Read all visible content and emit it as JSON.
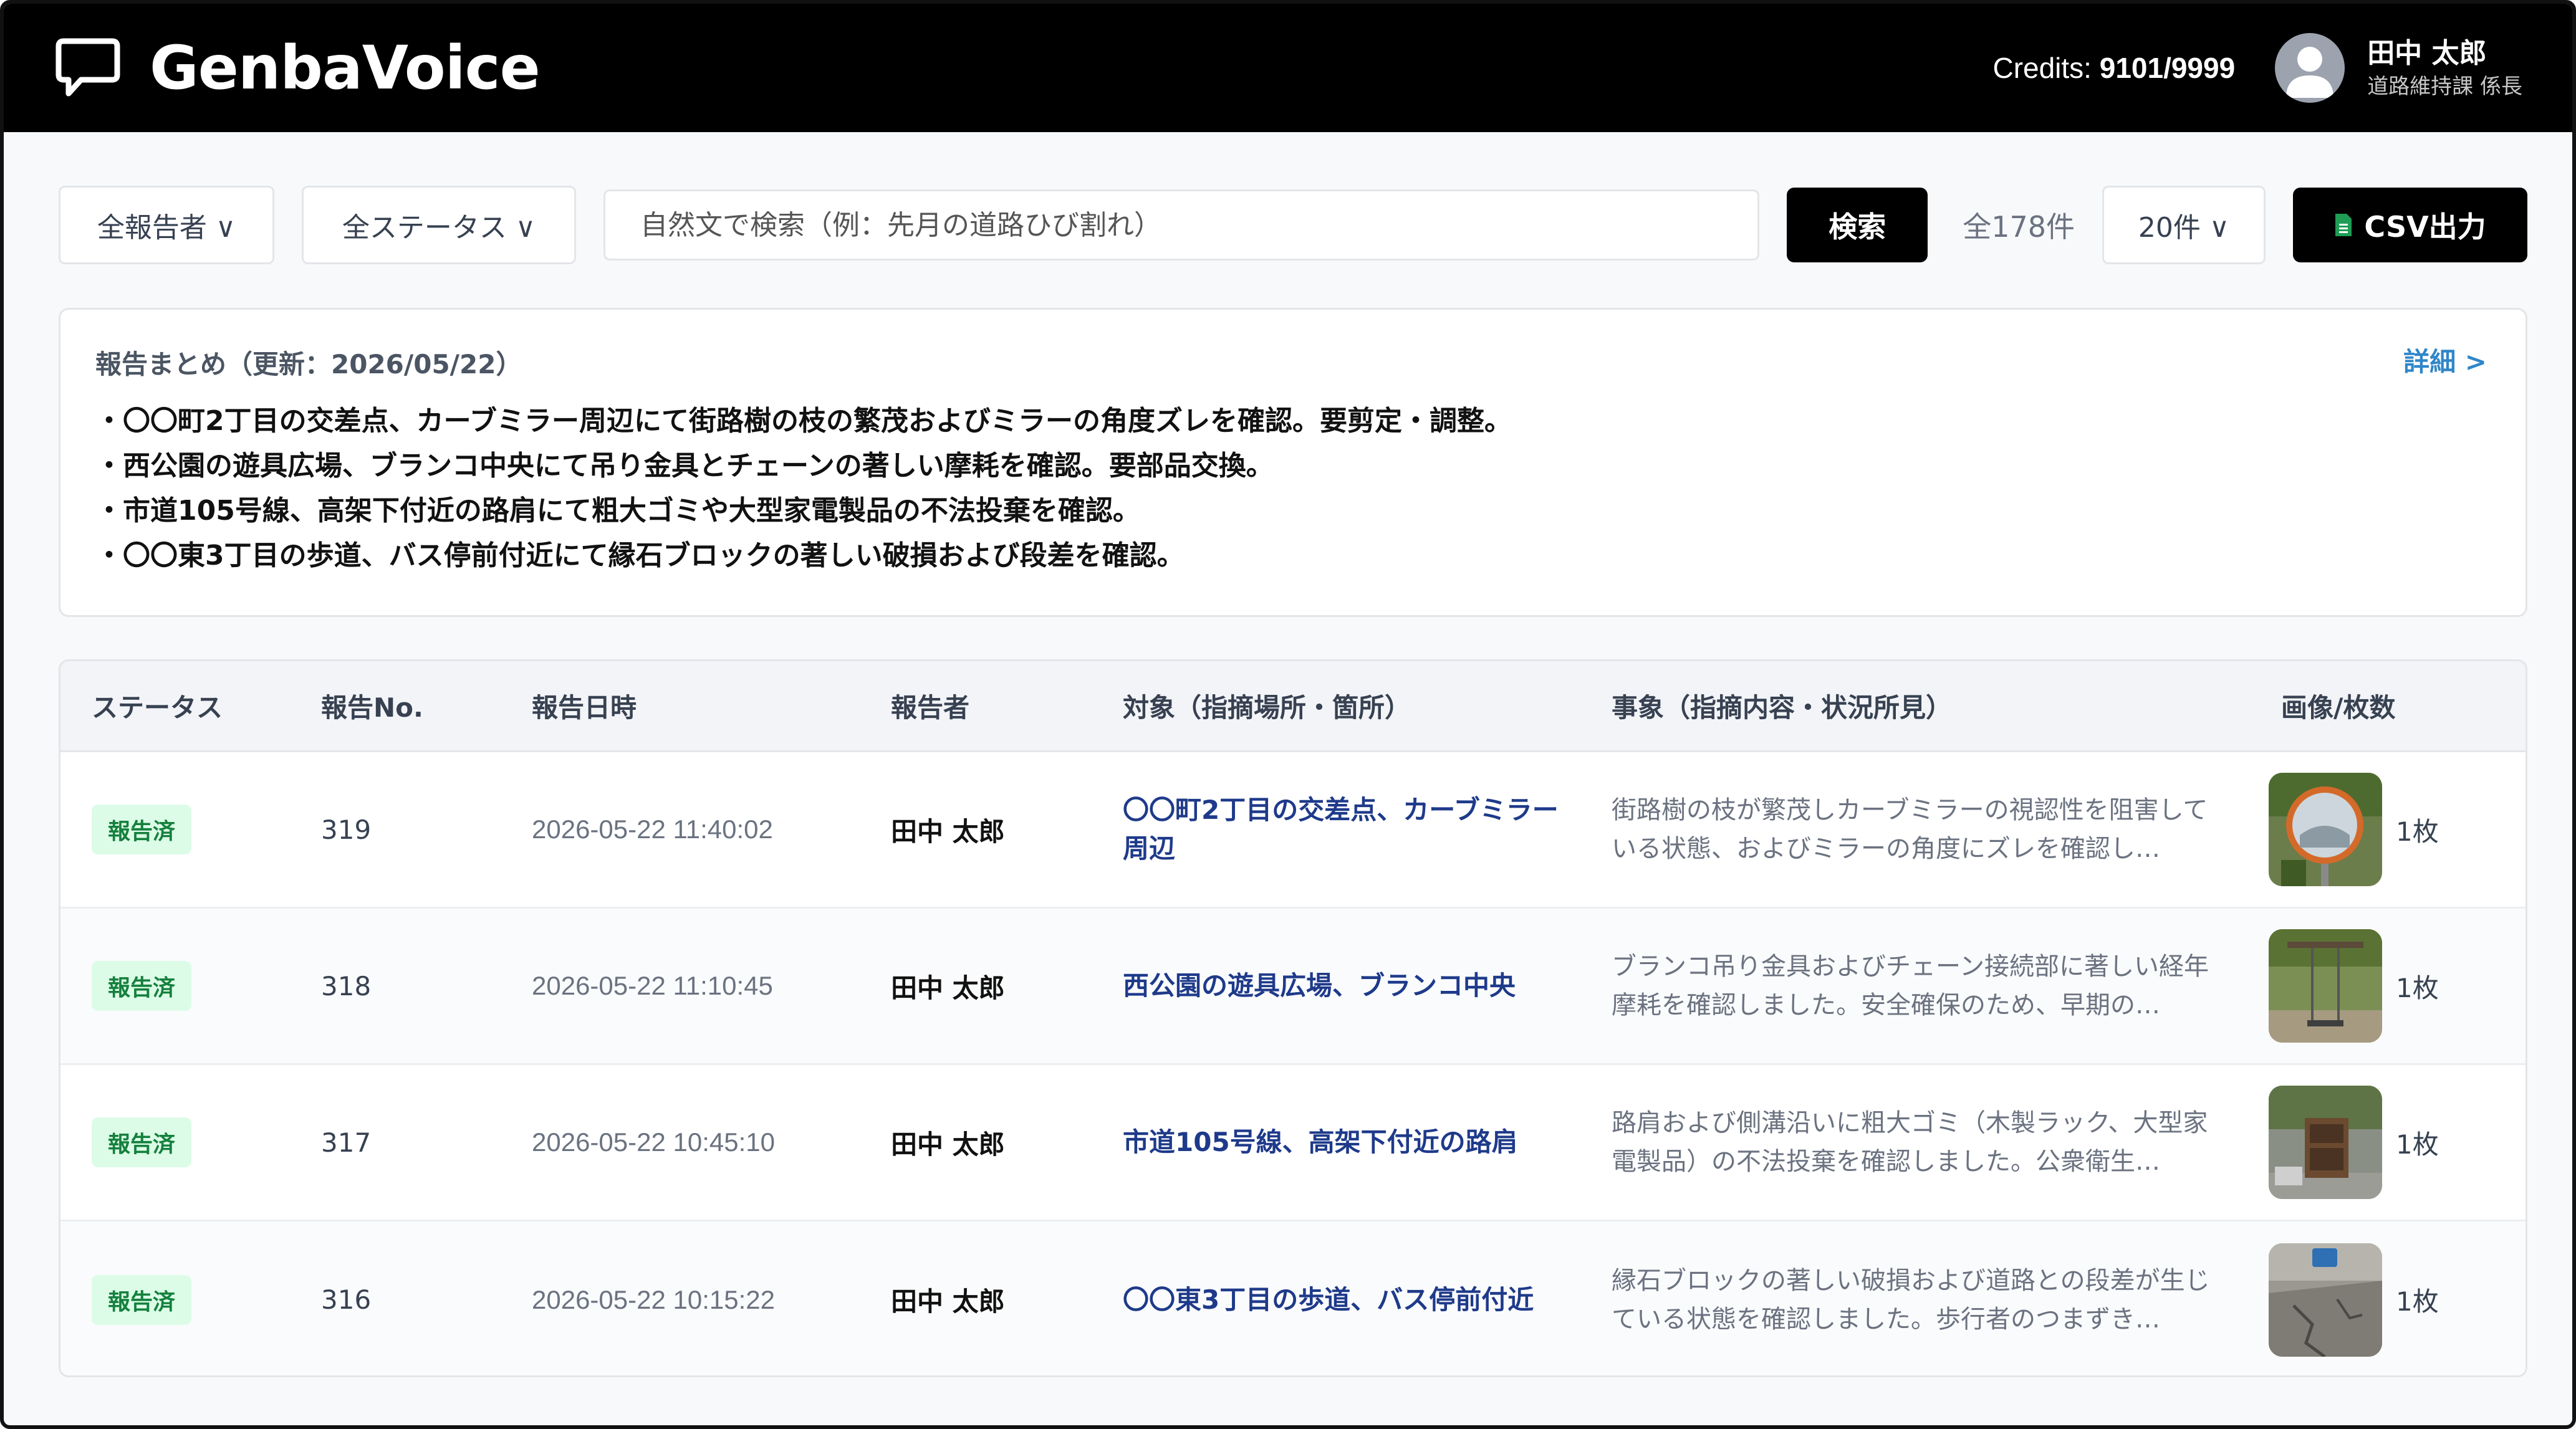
{
  "header": {
    "app_title": "GenbaVoice",
    "credits_label": "Credits:",
    "credits_value": "9101/9999",
    "user_name": "田中 太郎",
    "user_role": "道路維持課 係長"
  },
  "toolbar": {
    "reporter_filter": "全報告者 ∨",
    "status_filter": "全ステータス ∨",
    "search_placeholder": "自然文で検索（例：先月の道路ひび割れ）",
    "search_button": "検索",
    "total_count": "全178件",
    "page_size": "20件 ∨",
    "csv_button": "CSV出力"
  },
  "summary": {
    "title": "報告まとめ（更新：2026/05/22）",
    "detail_link": "詳細 >",
    "lines": [
      "・〇〇町2丁目の交差点、カーブミラー周辺にて街路樹の枝の繁茂およびミラーの角度ズレを確認。要剪定・調整。",
      "・西公園の遊具広場、ブランコ中央にて吊り金具とチェーンの著しい摩耗を確認。要部品交換。",
      "・市道105号線、高架下付近の路肩にて粗大ゴミや大型家電製品の不法投棄を確認。",
      "・〇〇東3丁目の歩道、バス停前付近にて縁石ブロックの著しい破損および段差を確認。"
    ]
  },
  "table": {
    "headers": {
      "status": "ステータス",
      "number": "報告No.",
      "datetime": "報告日時",
      "reporter": "報告者",
      "target": "対象（指摘場所・箇所）",
      "description": "事象（指摘内容・状況所見）",
      "images": "画像/枚数"
    },
    "rows": [
      {
        "status": "報告済",
        "number": "319",
        "datetime": "2026-05-22 11:40:02",
        "reporter": "田中 太郎",
        "target": "〇〇町2丁目の交差点、カーブミラー周辺",
        "description": "街路樹の枝が繁茂しカーブミラーの視認性を阻害している状態、およびミラーの角度にズレを確認し…",
        "image_count": "1枚"
      },
      {
        "status": "報告済",
        "number": "318",
        "datetime": "2026-05-22 11:10:45",
        "reporter": "田中 太郎",
        "target": "西公園の遊具広場、ブランコ中央",
        "description": "ブランコ吊り金具およびチェーン接続部に著しい経年摩耗を確認しました。安全確保のため、早期の…",
        "image_count": "1枚"
      },
      {
        "status": "報告済",
        "number": "317",
        "datetime": "2026-05-22 10:45:10",
        "reporter": "田中 太郎",
        "target": "市道105号線、高架下付近の路肩",
        "description": "路肩および側溝沿いに粗大ゴミ（木製ラック、大型家電製品）の不法投棄を確認しました。公衆衛生…",
        "image_count": "1枚"
      },
      {
        "status": "報告済",
        "number": "316",
        "datetime": "2026-05-22 10:15:22",
        "reporter": "田中 太郎",
        "target": "〇〇東3丁目の歩道、バス停前付近",
        "description": "縁石ブロックの著しい破損および道路との段差が生じている状態を確認しました。歩行者のつまずき…",
        "image_count": "1枚"
      }
    ]
  },
  "colors": {
    "header_bg": "#000000",
    "badge_bg": "#dcfce7",
    "badge_text": "#15803d",
    "link": "#2f86c9",
    "target_text": "#1e3a8a"
  }
}
